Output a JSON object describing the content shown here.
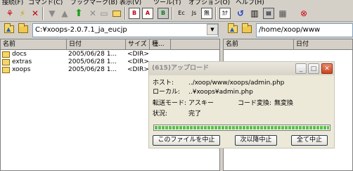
{
  "menu": [
    "接続(F)",
    "コマンド(C)",
    "ブックマーク(B)",
    "表示(V)",
    "ツール(T)",
    "オプション(O)",
    "ヘルプ(H)"
  ],
  "toolbar": {
    "bin_label": "B",
    "ascii_label": "A",
    "auto_label": "B",
    "euc_label": "Ec",
    "jis_label": "Js",
    "no_convert_label": "無",
    "kana_label": "ｶﾅ"
  },
  "local": {
    "path": "C:¥xoops-2.0.7.1_ja_eucjp",
    "columns": [
      "名前",
      "日付",
      "サイズ",
      "種..."
    ],
    "files": [
      {
        "name": "docs",
        "date": "2005/06/28 1...",
        "size": "<DIR>"
      },
      {
        "name": "extras",
        "date": "2005/06/28 1...",
        "size": "<DIR>"
      },
      {
        "name": "xoops",
        "date": "2005/06/28 1...",
        "size": "<DIR>"
      }
    ]
  },
  "remote": {
    "path": "/home/xoop/www",
    "columns": [
      "名前",
      "日付"
    ]
  },
  "dialog": {
    "title": "(615)アップロード",
    "host_label": "ホスト:",
    "host_value": "../xoop/www/xoops/admin.php",
    "local_label": "ローカル:",
    "local_value": "..¥xoops¥admin.php",
    "mode_label": "転送モード:",
    "mode_value": "アスキー",
    "code_label": "コード変換:",
    "code_value": "無変換",
    "status_label": "状況:",
    "status_value": "完了",
    "progress": 1.0,
    "btn_cancel_file": "このファイルを中止",
    "btn_cancel_after": "次以降中止",
    "btn_cancel_all": "全て中止"
  }
}
